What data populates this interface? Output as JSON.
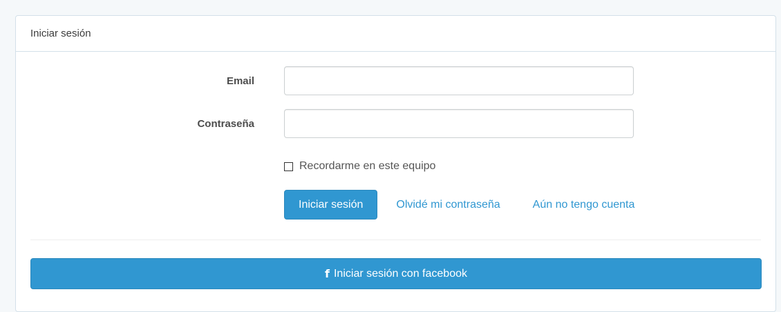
{
  "panel": {
    "heading": "Iniciar sesión"
  },
  "form": {
    "email_label": "Email",
    "email_value": "",
    "password_label": "Contraseña",
    "password_value": "",
    "remember_label": "Recordarme en este equipo",
    "remember_checked": false
  },
  "actions": {
    "login_button": "Iniciar sesión",
    "forgot_link": "Olvidé mi contraseña",
    "register_link": "Aún no tengo cuenta"
  },
  "facebook": {
    "icon": "facebook-icon",
    "glyph": "f",
    "button_label": "Iniciar sesión con facebook"
  },
  "colors": {
    "primary": "#3097d1",
    "border": "#d3e0e9",
    "background": "#f5f8fa"
  }
}
